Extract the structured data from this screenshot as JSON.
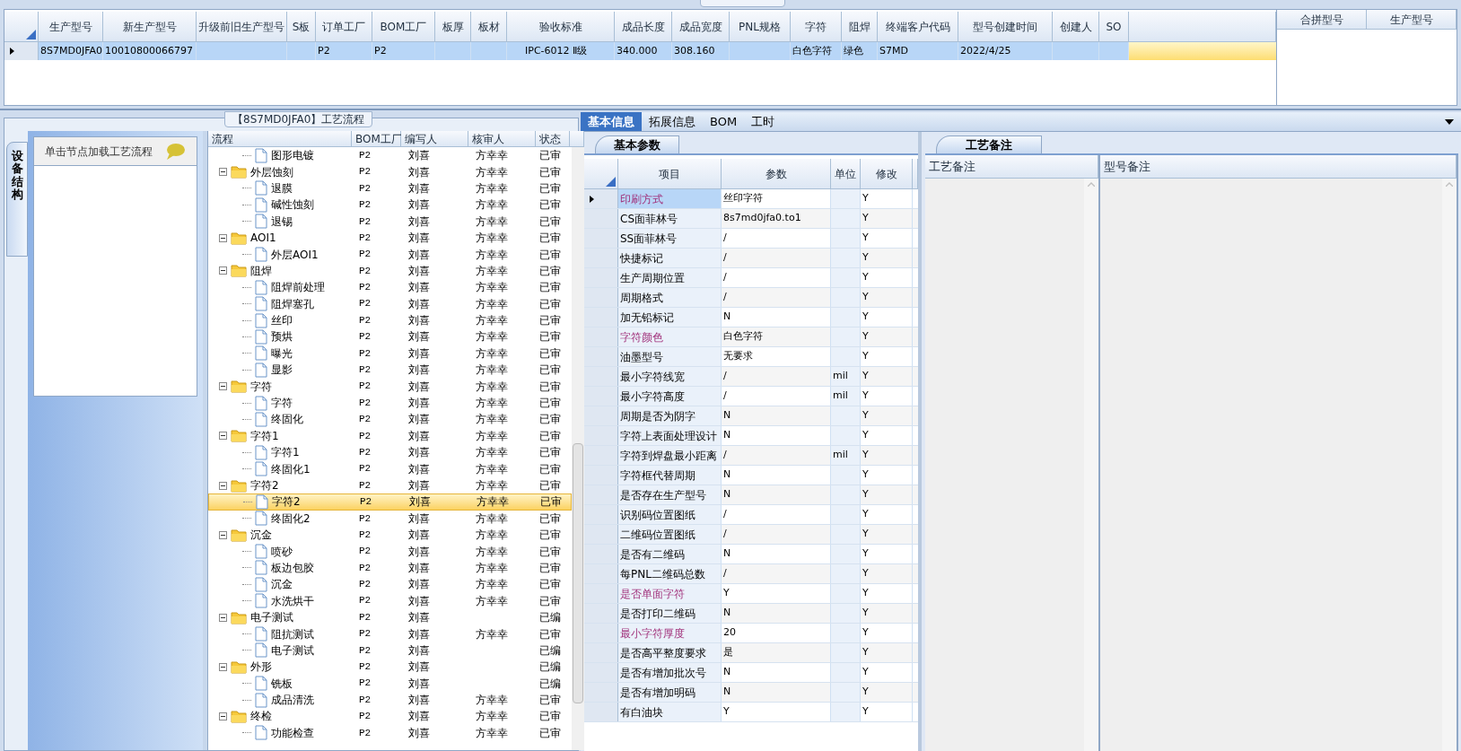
{
  "top_panel": {
    "columns": [
      "生产型号",
      "新生产型号",
      "升级前旧生产型号",
      "S板",
      "订单工厂",
      "BOM工厂",
      "板厚",
      "板材",
      "验收标准",
      "成品长度",
      "成品宽度",
      "PNL规格",
      "字符",
      "阻焊",
      "终端客户代码",
      "型号创建时间",
      "创建人",
      "SO"
    ],
    "rows": [
      {
        "selected": true,
        "cells": [
          "8S7MD0JFA0",
          "10010800066797",
          null,
          null,
          "P2",
          "P2",
          null,
          null,
          "IPC-6012 Ⅱ级",
          "340.000",
          "308.160",
          null,
          "白色字符",
          "绿色",
          "S7MD",
          "2022/4/25",
          null,
          null
        ]
      }
    ]
  },
  "merge_table": {
    "columns": [
      "合拼型号",
      "生产型号"
    ]
  },
  "flow_panel": {
    "title": "【8S7MD0JFA0】工艺流程",
    "side_tab": "设备结构",
    "hint": "单击节点加载工艺流程",
    "columns": [
      "流程",
      "BOM工厂",
      "编写人",
      "核审人",
      "状态"
    ],
    "nodes": [
      {
        "children": [
          {
            "name": "图形电镀",
            "bom": "P2",
            "writer": "刘喜",
            "reviewer": "方幸幸",
            "status": "已审",
            "selected": false
          }
        ]
      },
      {
        "name": "外层蚀刻",
        "bom": "P2",
        "writer": "刘喜",
        "reviewer": "方幸幸",
        "status": "已审",
        "selected": false,
        "expanded": true,
        "children": [
          {
            "name": "退膜",
            "bom": "P2",
            "writer": "刘喜",
            "reviewer": "方幸幸",
            "status": "已审",
            "selected": false
          },
          {
            "name": "碱性蚀刻",
            "bom": "P2",
            "writer": "刘喜",
            "reviewer": "方幸幸",
            "status": "已审",
            "selected": false
          },
          {
            "name": "退锡",
            "bom": "P2",
            "writer": "刘喜",
            "reviewer": "方幸幸",
            "status": "已审",
            "selected": false
          }
        ]
      },
      {
        "name": "AOI1",
        "bom": "P2",
        "writer": "刘喜",
        "reviewer": "方幸幸",
        "status": "已审",
        "selected": false,
        "expanded": true,
        "children": [
          {
            "name": "外层AOI1",
            "bom": "P2",
            "writer": "刘喜",
            "reviewer": "方幸幸",
            "status": "已审",
            "selected": false
          }
        ]
      },
      {
        "name": "阻焊",
        "bom": "P2",
        "writer": "刘喜",
        "reviewer": "方幸幸",
        "status": "已审",
        "selected": false,
        "expanded": true,
        "children": [
          {
            "name": "阻焊前处理",
            "bom": "P2",
            "writer": "刘喜",
            "reviewer": "方幸幸",
            "status": "已审",
            "selected": false
          },
          {
            "name": "阻焊塞孔",
            "bom": "P2",
            "writer": "刘喜",
            "reviewer": "方幸幸",
            "status": "已审",
            "selected": false
          },
          {
            "name": "丝印",
            "bom": "P2",
            "writer": "刘喜",
            "reviewer": "方幸幸",
            "status": "已审",
            "selected": false
          },
          {
            "name": "预烘",
            "bom": "P2",
            "writer": "刘喜",
            "reviewer": "方幸幸",
            "status": "已审",
            "selected": false
          },
          {
            "name": "曝光",
            "bom": "P2",
            "writer": "刘喜",
            "reviewer": "方幸幸",
            "status": "已审",
            "selected": false
          },
          {
            "name": "显影",
            "bom": "P2",
            "writer": "刘喜",
            "reviewer": "方幸幸",
            "status": "已审",
            "selected": false
          }
        ]
      },
      {
        "name": "字符",
        "bom": "P2",
        "writer": "刘喜",
        "reviewer": "方幸幸",
        "status": "已审",
        "selected": false,
        "expanded": true,
        "children": [
          {
            "name": "字符",
            "bom": "P2",
            "writer": "刘喜",
            "reviewer": "方幸幸",
            "status": "已审",
            "selected": false
          },
          {
            "name": "终固化",
            "bom": "P2",
            "writer": "刘喜",
            "reviewer": "方幸幸",
            "status": "已审",
            "selected": false
          }
        ]
      },
      {
        "name": "字符1",
        "bom": "P2",
        "writer": "刘喜",
        "reviewer": "方幸幸",
        "status": "已审",
        "selected": false,
        "expanded": true,
        "children": [
          {
            "name": "字符1",
            "bom": "P2",
            "writer": "刘喜",
            "reviewer": "方幸幸",
            "status": "已审",
            "selected": false
          },
          {
            "name": "终固化1",
            "bom": "P2",
            "writer": "刘喜",
            "reviewer": "方幸幸",
            "status": "已审",
            "selected": false
          }
        ]
      },
      {
        "name": "字符2",
        "bom": "P2",
        "writer": "刘喜",
        "reviewer": "方幸幸",
        "status": "已审",
        "selected": false,
        "expanded": true,
        "children": [
          {
            "name": "字符2",
            "bom": "P2",
            "writer": "刘喜",
            "reviewer": "方幸幸",
            "status": "已审",
            "selected": true
          },
          {
            "name": "终固化2",
            "bom": "P2",
            "writer": "刘喜",
            "reviewer": "方幸幸",
            "status": "已审",
            "selected": false
          }
        ]
      },
      {
        "name": "沉金",
        "bom": "P2",
        "writer": "刘喜",
        "reviewer": "方幸幸",
        "status": "已审",
        "selected": false,
        "expanded": true,
        "children": [
          {
            "name": "喷砂",
            "bom": "P2",
            "writer": "刘喜",
            "reviewer": "方幸幸",
            "status": "已审",
            "selected": false
          },
          {
            "name": "板边包胶",
            "bom": "P2",
            "writer": "刘喜",
            "reviewer": "方幸幸",
            "status": "已审",
            "selected": false
          },
          {
            "name": "沉金",
            "bom": "P2",
            "writer": "刘喜",
            "reviewer": "方幸幸",
            "status": "已审",
            "selected": false
          },
          {
            "name": "水洗烘干",
            "bom": "P2",
            "writer": "刘喜",
            "reviewer": "方幸幸",
            "status": "已审",
            "selected": false
          }
        ]
      },
      {
        "name": "电子测试",
        "bom": "P2",
        "writer": "刘喜",
        "status": "已编",
        "selected": false,
        "expanded": true,
        "children": [
          {
            "name": "阻抗测试",
            "bom": "P2",
            "writer": "刘喜",
            "reviewer": "方幸幸",
            "status": "已审",
            "selected": false
          },
          {
            "name": "电子测试",
            "bom": "P2",
            "writer": "刘喜",
            "status": "已编",
            "selected": false
          }
        ]
      },
      {
        "name": "外形",
        "bom": "P2",
        "writer": "刘喜",
        "status": "已编",
        "selected": false,
        "expanded": true,
        "children": [
          {
            "name": "铣板",
            "bom": "P2",
            "writer": "刘喜",
            "status": "已编",
            "selected": false
          },
          {
            "name": "成品清洗",
            "bom": "P2",
            "writer": "刘喜",
            "reviewer": "方幸幸",
            "status": "已审",
            "selected": false
          }
        ]
      },
      {
        "name": "终检",
        "bom": "P2",
        "writer": "刘喜",
        "reviewer": "方幸幸",
        "status": "已审",
        "selected": false,
        "expanded": true,
        "children": [
          {
            "name": "功能检查",
            "bom": "P2",
            "writer": "刘喜",
            "reviewer": "方幸幸",
            "status": "已审",
            "selected": false
          }
        ]
      }
    ]
  },
  "detail_tabs": [
    {
      "label": "基本信息",
      "selected": true
    },
    {
      "label": "拓展信息",
      "selected": false
    },
    {
      "label": "BOM",
      "selected": false
    },
    {
      "label": "工时",
      "selected": false
    }
  ],
  "params_panel": {
    "tab": "基本参数",
    "columns": [
      "项目",
      "参数",
      "单位",
      "修改"
    ],
    "rows": [
      {
        "item": "印刷方式",
        "value": "丝印字符",
        "modify": "Y",
        "highlight": true,
        "selected": true
      },
      {
        "item": "CS面菲林号",
        "value": "8s7md0jfa0.to1",
        "modify": "Y",
        "highlight": false,
        "selected": false
      },
      {
        "item": "SS面菲林号",
        "value": "/",
        "modify": "Y",
        "highlight": false,
        "selected": false
      },
      {
        "item": "快捷标记",
        "value": "/",
        "modify": "Y",
        "highlight": false,
        "selected": false
      },
      {
        "item": "生产周期位置",
        "value": "/",
        "modify": "Y",
        "highlight": false,
        "selected": false
      },
      {
        "item": "周期格式",
        "value": "/",
        "modify": "Y",
        "highlight": false,
        "selected": false
      },
      {
        "item": "加无铅标记",
        "value": "N",
        "modify": "Y",
        "highlight": false,
        "selected": false
      },
      {
        "item": "字符颜色",
        "value": "白色字符",
        "modify": "Y",
        "highlight": true,
        "selected": false
      },
      {
        "item": "油墨型号",
        "value": "无要求",
        "modify": "Y",
        "highlight": false,
        "selected": false
      },
      {
        "item": "最小字符线宽",
        "value": "/",
        "unit": "mil",
        "modify": "Y",
        "highlight": false,
        "selected": false
      },
      {
        "item": "最小字符高度",
        "value": "/",
        "unit": "mil",
        "modify": "Y",
        "highlight": false,
        "selected": false
      },
      {
        "item": "周期是否为阴字",
        "value": "N",
        "modify": "Y",
        "highlight": false,
        "selected": false
      },
      {
        "item": "字符上表面处理设计",
        "value": "N",
        "modify": "Y",
        "highlight": false,
        "selected": false
      },
      {
        "item": "字符到焊盘最小距离",
        "value": "/",
        "unit": "mil",
        "modify": "Y",
        "highlight": false,
        "selected": false
      },
      {
        "item": "字符框代替周期",
        "value": "N",
        "modify": "Y",
        "highlight": false,
        "selected": false
      },
      {
        "item": "是否存在生产型号",
        "value": "N",
        "modify": "Y",
        "highlight": false,
        "selected": false
      },
      {
        "item": "识别码位置图纸",
        "value": "/",
        "modify": "Y",
        "highlight": false,
        "selected": false
      },
      {
        "item": "二维码位置图纸",
        "value": "/",
        "modify": "Y",
        "highlight": false,
        "selected": false
      },
      {
        "item": "是否有二维码",
        "value": "N",
        "modify": "Y",
        "highlight": false,
        "selected": false
      },
      {
        "item": "每PNL二维码总数",
        "value": "/",
        "modify": "Y",
        "highlight": false,
        "selected": false
      },
      {
        "item": "是否单面字符",
        "value": "Y",
        "modify": "Y",
        "highlight": true,
        "selected": false
      },
      {
        "item": "是否打印二维码",
        "value": "N",
        "modify": "Y",
        "highlight": false,
        "selected": false
      },
      {
        "item": "最小字符厚度",
        "value": "20",
        "modify": "Y",
        "highlight": true,
        "selected": false
      },
      {
        "item": "是否高平整度要求",
        "value": "是",
        "modify": "Y",
        "highlight": false,
        "selected": false
      },
      {
        "item": "是否有增加批次号",
        "value": "N",
        "modify": "Y",
        "highlight": false,
        "selected": false
      },
      {
        "item": "是否有增加明码",
        "value": "N",
        "modify": "Y",
        "highlight": false,
        "selected": false
      },
      {
        "item": "有白油块",
        "value": "Y",
        "modify": "Y",
        "highlight": false,
        "selected": false
      }
    ]
  },
  "notes_panel": {
    "tab": "工艺备注",
    "columns": [
      "工艺备注",
      "型号备注"
    ]
  }
}
